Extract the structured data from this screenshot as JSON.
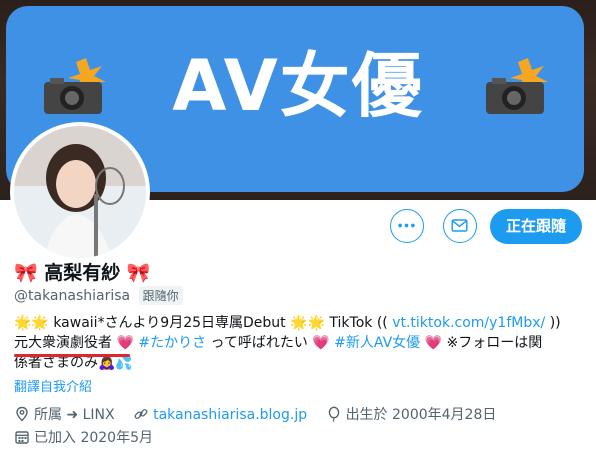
{
  "banner": {
    "text": "AV女優"
  },
  "profile": {
    "name": "🎀 高梨有紗 🎀",
    "handle": "@takanashiarisa",
    "follows_you": "跟隨你"
  },
  "actions": {
    "follow_label": "正在跟隨"
  },
  "bio": {
    "line1_a": "🌟🌟 kawaii*さんより9月25日専属Debut 🌟🌟 TikTok ((",
    "line1_link": "vt.tiktok.com/y1fMbx/",
    "line1_b": "))",
    "line2_underlined": "元大衆演劇役者",
    "line2_heart1": "💗",
    "line2_tag1": "#たかりさ",
    "line2_mid": "って呼ばれたい 💗",
    "line2_tag2": "#新人AV女優",
    "line2_end": "💗 ※フォローは関",
    "line3": "係者さまのみ🙇‍♀️💦",
    "translate": "翻譯自我介紹"
  },
  "meta": {
    "location": "所属 ➜ LINX",
    "website": "takanashiarisa.blog.jp",
    "birthday": "出生於 2000年4月28日",
    "joined": "已加入 2020年5月"
  },
  "colors": {
    "accent": "#1d9bf0",
    "banner_blue": "#3f91e6",
    "underline_red": "#e2242c"
  }
}
